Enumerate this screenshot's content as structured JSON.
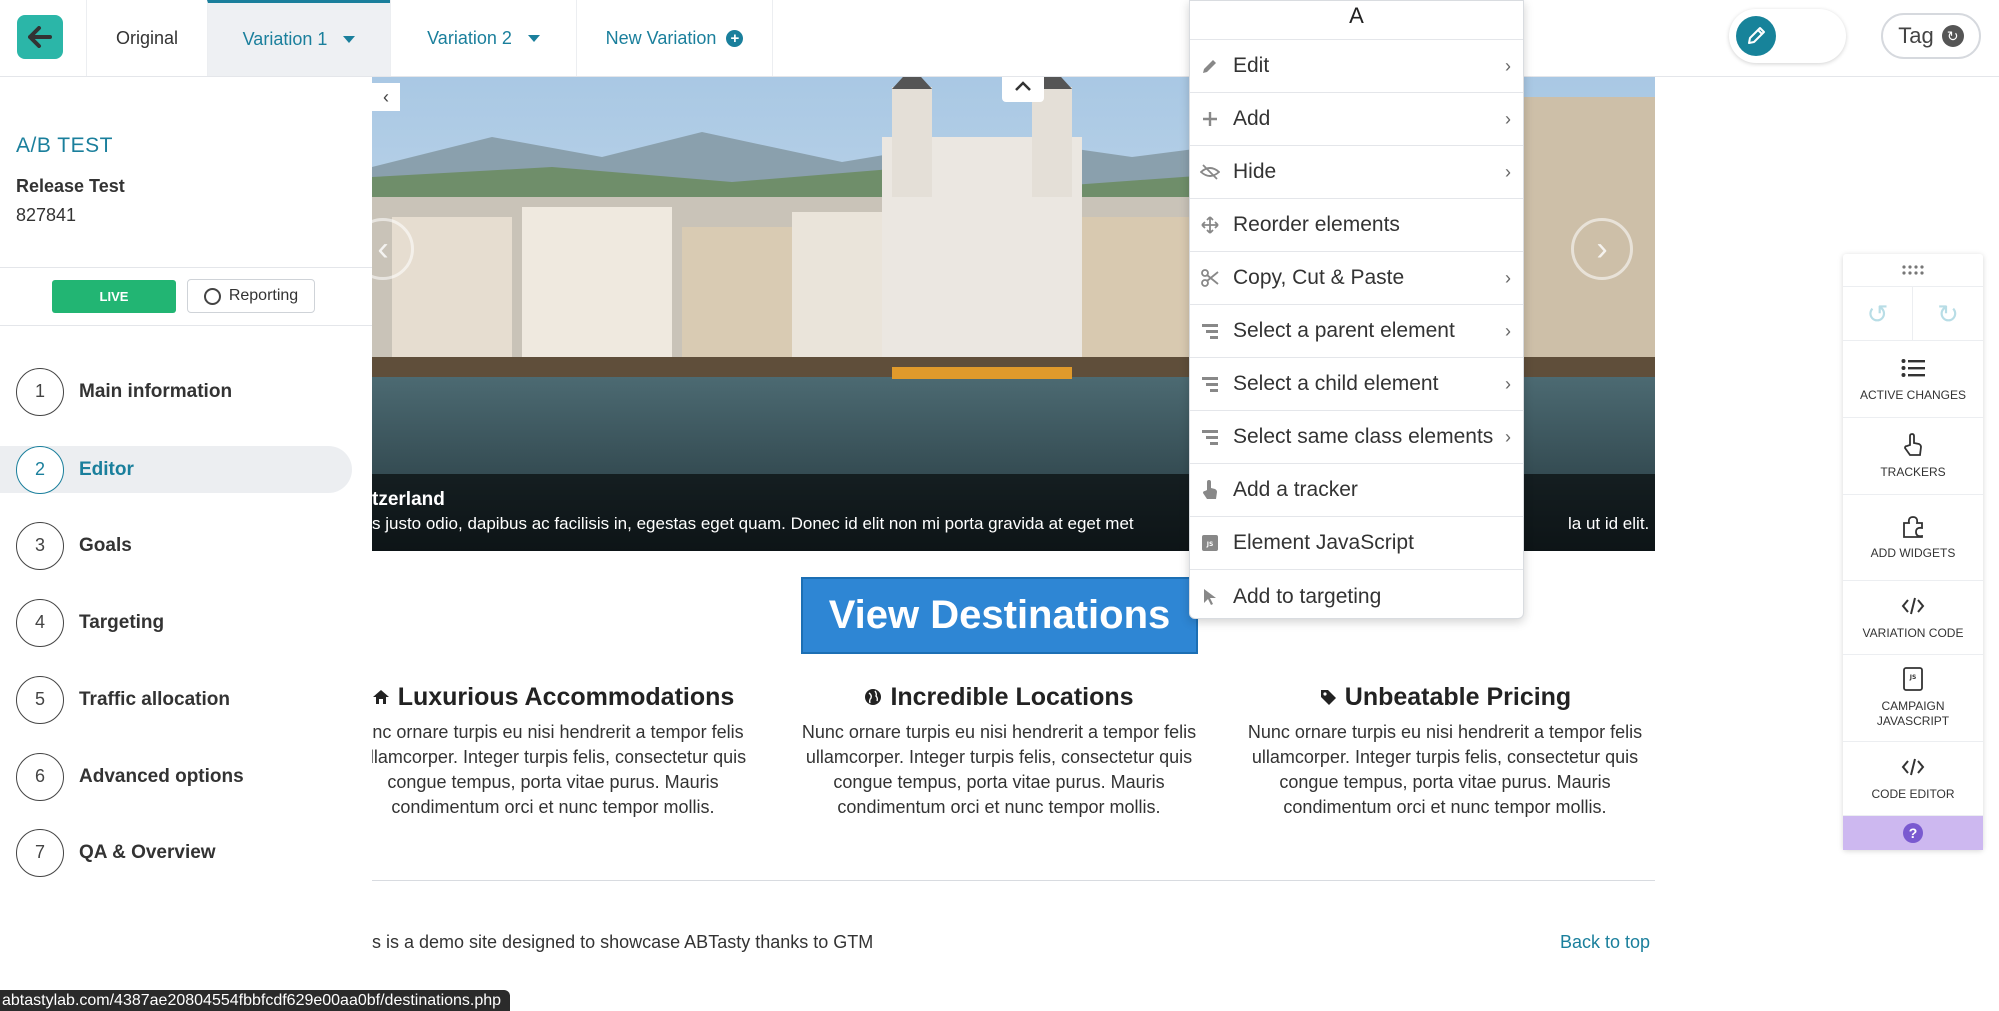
{
  "topbar": {
    "tabs": [
      {
        "label": "Original"
      },
      {
        "label": "Variation 1"
      },
      {
        "label": "Variation 2"
      },
      {
        "label": "New Variation"
      }
    ],
    "tag_label": "Tag"
  },
  "sidebar": {
    "test_type": "A/B TEST",
    "test_name": "Release Test",
    "test_id": "827841",
    "live_badge": "LIVE",
    "reporting_label": "Reporting",
    "steps": [
      {
        "num": "1",
        "label": "Main information"
      },
      {
        "num": "2",
        "label": "Editor"
      },
      {
        "num": "3",
        "label": "Goals"
      },
      {
        "num": "4",
        "label": "Targeting"
      },
      {
        "num": "5",
        "label": "Traffic allocation"
      },
      {
        "num": "6",
        "label": "Advanced options"
      },
      {
        "num": "7",
        "label": "QA & Overview"
      }
    ]
  },
  "preview": {
    "caption_title": "tzerland",
    "caption_text": "s justo odio, dapibus ac facilisis in, egestas eget quam. Donec id elit non mi porta gravida at eget met",
    "caption_text_end": "la ut id elit.",
    "cta_label": "View Destinations",
    "features": [
      {
        "title": "Luxurious Accommodations",
        "icon": "home-icon",
        "text": "unc ornare turpis eu nisi hendrerit a tempor felis ullamcorper. Integer turpis felis, consectetur quis congue tempus, porta vitae purus. Mauris condimentum orci et nunc tempor mollis."
      },
      {
        "title": "Incredible Locations",
        "icon": "globe-icon",
        "text": "Nunc ornare turpis eu nisi hendrerit a tempor felis ullamcorper. Integer turpis felis, consectetur quis congue tempus, porta vitae purus. Mauris condimentum orci et nunc tempor mollis."
      },
      {
        "title": "Unbeatable Pricing",
        "icon": "tag-icon",
        "text": "Nunc ornare turpis eu nisi hendrerit a tempor felis ullamcorper. Integer turpis felis, consectetur quis congue tempus, porta vitae purus. Mauris condimentum orci et nunc tempor mollis."
      }
    ],
    "footer_text": "s is a demo site designed to showcase ABTasty thanks to GTM",
    "back_to_top": "Back to top"
  },
  "status_url": "abtastylab.com/4387ae20804554fbbfcdf629e00aa0bf/destinations.php",
  "context_menu": {
    "header": "A",
    "items": [
      {
        "label": "Edit",
        "icon": "pencil-icon",
        "submenu": true
      },
      {
        "label": "Add",
        "icon": "plus-icon",
        "submenu": true
      },
      {
        "label": "Hide",
        "icon": "eye-slash-icon",
        "submenu": true
      },
      {
        "label": "Reorder elements",
        "icon": "move-arrows-icon",
        "submenu": false
      },
      {
        "label": "Copy, Cut & Paste",
        "icon": "scissors-icon",
        "submenu": true
      },
      {
        "label": "Select a parent element",
        "icon": "hierarchy-icon",
        "submenu": true
      },
      {
        "label": "Select a child element",
        "icon": "hierarchy-icon",
        "submenu": true
      },
      {
        "label": "Select same class elements",
        "icon": "hierarchy-icon",
        "submenu": true
      },
      {
        "label": "Add a tracker",
        "icon": "hand-pointer-icon",
        "submenu": false
      },
      {
        "label": "Element JavaScript",
        "icon": "js-file-icon",
        "submenu": false
      },
      {
        "label": "Add to targeting",
        "icon": "cursor-arrow-icon",
        "submenu": false
      }
    ]
  },
  "tool_panel": {
    "items": [
      {
        "label": "ACTIVE CHANGES",
        "icon": "list-icon"
      },
      {
        "label": "TRACKERS",
        "icon": "hand-pointer-icon"
      },
      {
        "label": "ADD WIDGETS",
        "icon": "puzzle-icon"
      },
      {
        "label": "VARIATION CODE",
        "icon": "code-icon"
      },
      {
        "label": "CAMPAIGN JAVASCRIPT",
        "icon": "js-file-icon"
      },
      {
        "label": "CODE EDITOR",
        "icon": "code-icon"
      }
    ],
    "help": "?"
  },
  "colors": {
    "accent": "#1a7f9c",
    "teal_button": "#2bb6a8",
    "live_green": "#22b573",
    "cta_blue": "#2e86d4",
    "help_purple": "#cdb8f0"
  }
}
